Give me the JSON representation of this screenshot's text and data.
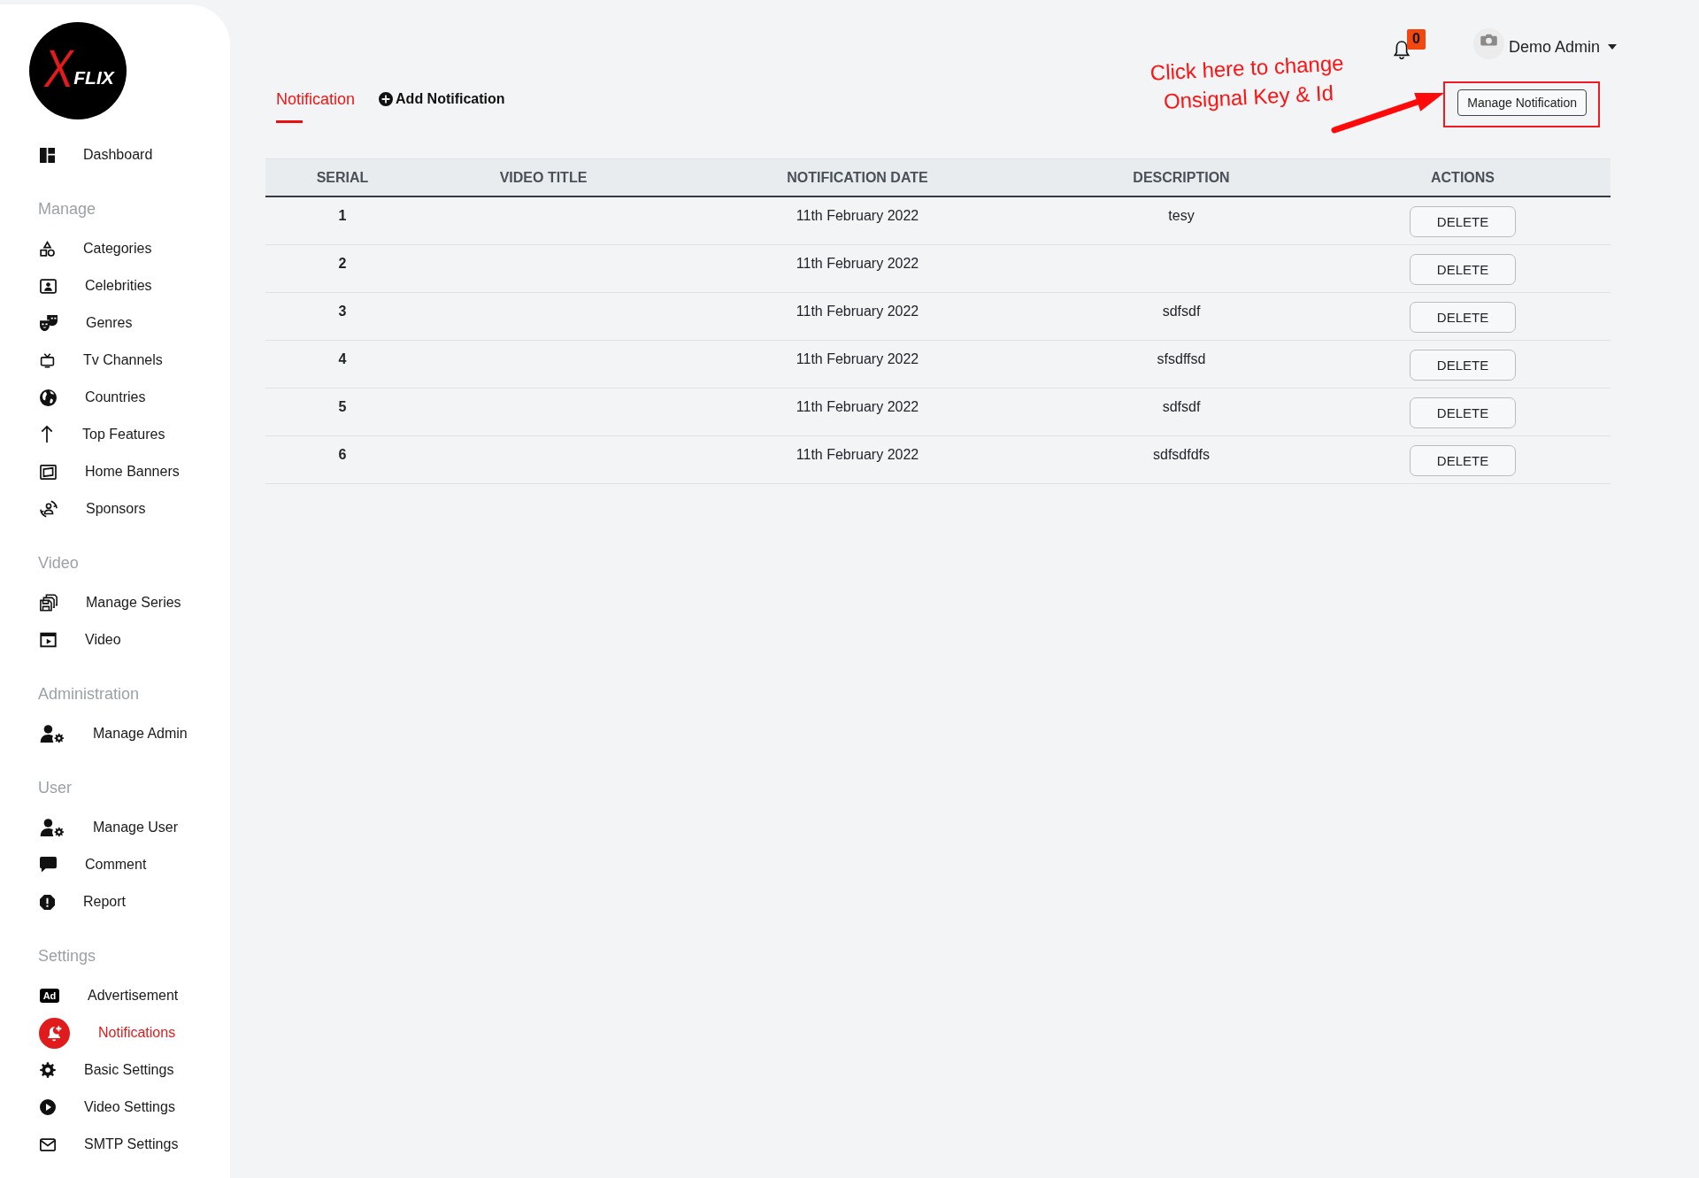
{
  "sidebar": {
    "logo": {
      "mark": "X",
      "name": "FLIX"
    },
    "groups": [
      {
        "items": [
          {
            "label": "Dashboard",
            "selected": false
          }
        ]
      },
      {
        "heading": "Manage",
        "items": [
          {
            "label": "Categories",
            "selected": false
          },
          {
            "label": "Celebrities",
            "selected": false
          },
          {
            "label": "Genres",
            "selected": false
          },
          {
            "label": "Tv Channels",
            "selected": false
          },
          {
            "label": "Countries",
            "selected": false
          },
          {
            "label": "Top Features",
            "selected": false
          },
          {
            "label": "Home Banners",
            "selected": false
          },
          {
            "label": "Sponsors",
            "selected": false
          }
        ]
      },
      {
        "heading": "Video",
        "items": [
          {
            "label": "Manage Series",
            "selected": false
          },
          {
            "label": "Video",
            "selected": false
          }
        ]
      },
      {
        "heading": "Administration",
        "items": [
          {
            "label": "Manage Admin",
            "selected": false
          }
        ]
      },
      {
        "heading": "User",
        "items": [
          {
            "label": "Manage User",
            "selected": false
          },
          {
            "label": "Comment",
            "selected": false
          },
          {
            "label": "Report",
            "selected": false
          }
        ]
      },
      {
        "heading": "Settings",
        "items": [
          {
            "label": "Advertisement",
            "icon_text": "Ad",
            "selected": false
          },
          {
            "label": "Notifications",
            "selected": true
          },
          {
            "label": "Basic Settings",
            "selected": false
          },
          {
            "label": "Video Settings",
            "selected": false
          },
          {
            "label": "SMTP Settings",
            "selected": false
          }
        ]
      }
    ]
  },
  "header": {
    "notifications": {
      "count": "0"
    },
    "user": {
      "name": "Demo Admin"
    }
  },
  "tabs": [
    {
      "label": "Notification",
      "kind": "link",
      "selected": true
    },
    {
      "label": "Add Notification",
      "kind": "add",
      "selected": false
    }
  ],
  "manage_button": {
    "label": "Manage Notification"
  },
  "annotation": {
    "lines": [
      "Click here to change",
      "Onsignal Key & Id"
    ]
  },
  "table": {
    "columns": [
      "SERIAL",
      "VIDEO TITLE",
      "NOTIFICATION DATE",
      "DESCRIPTION",
      "ACTIONS"
    ],
    "rows": [
      {
        "serial": "1",
        "notification_date": "11th February 2022",
        "description": "tesy",
        "action": "DELETE"
      },
      {
        "serial": "2",
        "notification_date": "11th February 2022",
        "action": "DELETE"
      },
      {
        "serial": "3",
        "notification_date": "11th February 2022",
        "description": "sdfsdf",
        "action": "DELETE"
      },
      {
        "serial": "4",
        "notification_date": "11th February 2022",
        "description": "sfsdffsd",
        "action": "DELETE"
      },
      {
        "serial": "5",
        "notification_date": "11th February 2022",
        "description": "sdfsdf",
        "action": "DELETE"
      },
      {
        "serial": "6",
        "notification_date": "11th February 2022",
        "description": "sdfsdfdfs",
        "action": "DELETE"
      }
    ]
  }
}
